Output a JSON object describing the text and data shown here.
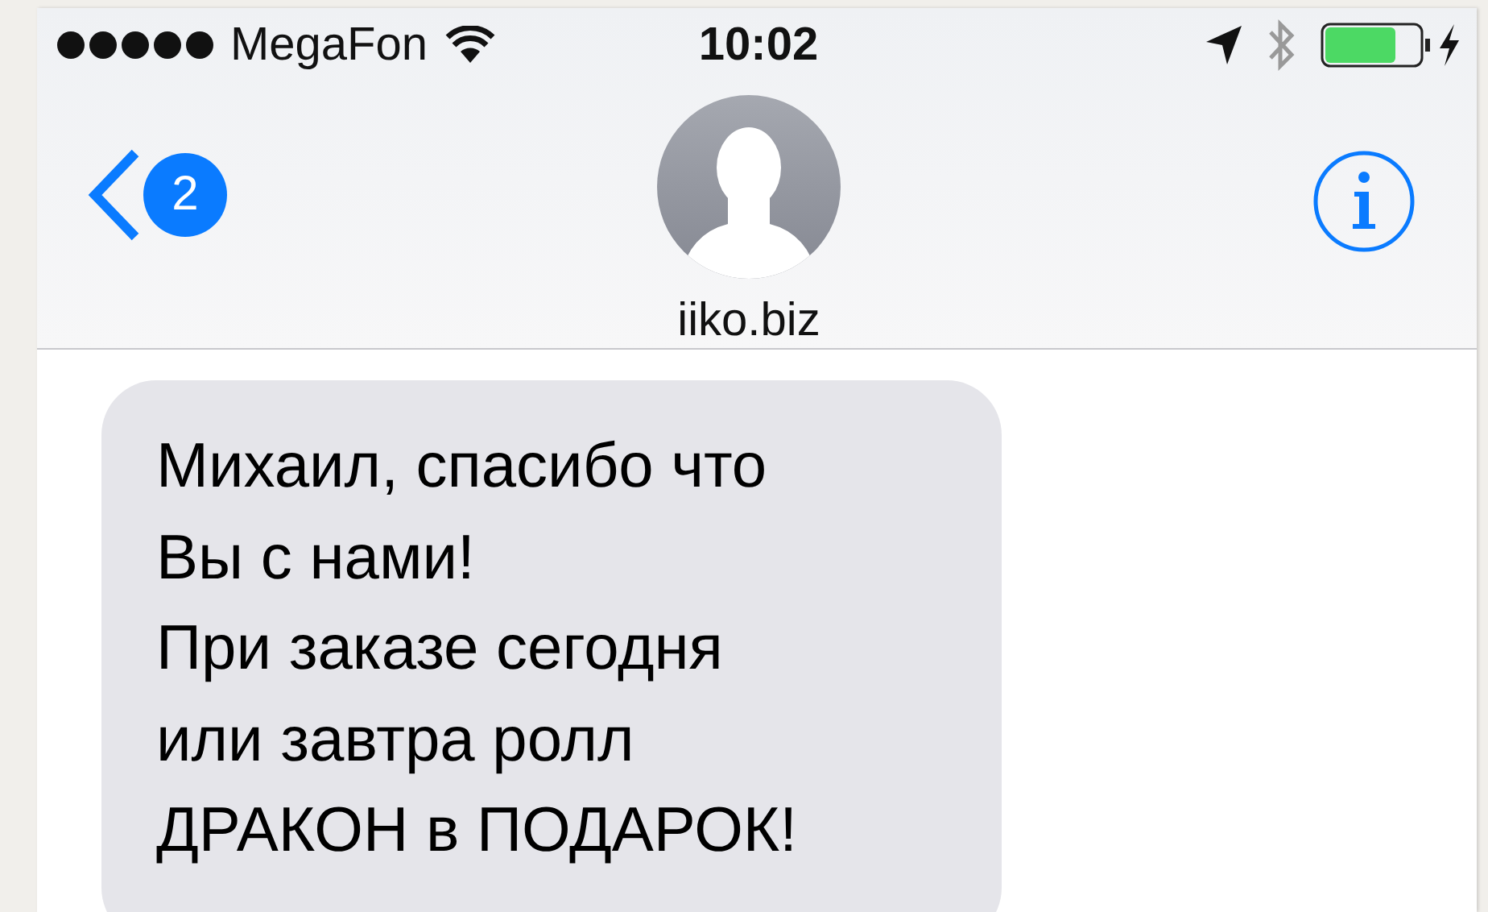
{
  "status_bar": {
    "carrier": "MegaFon",
    "time": "10:02",
    "battery": {
      "level": 0.75,
      "charging": true
    }
  },
  "nav": {
    "back_badge": "2",
    "contact": "iiko.biz"
  },
  "messages": [
    {
      "kind": "incoming",
      "text": "Михаил, спасибо что\nВы с нами!\nПри заказе сегодня\nили завтра ролл\nДРАКОН в ПОДАРОК!"
    }
  ]
}
